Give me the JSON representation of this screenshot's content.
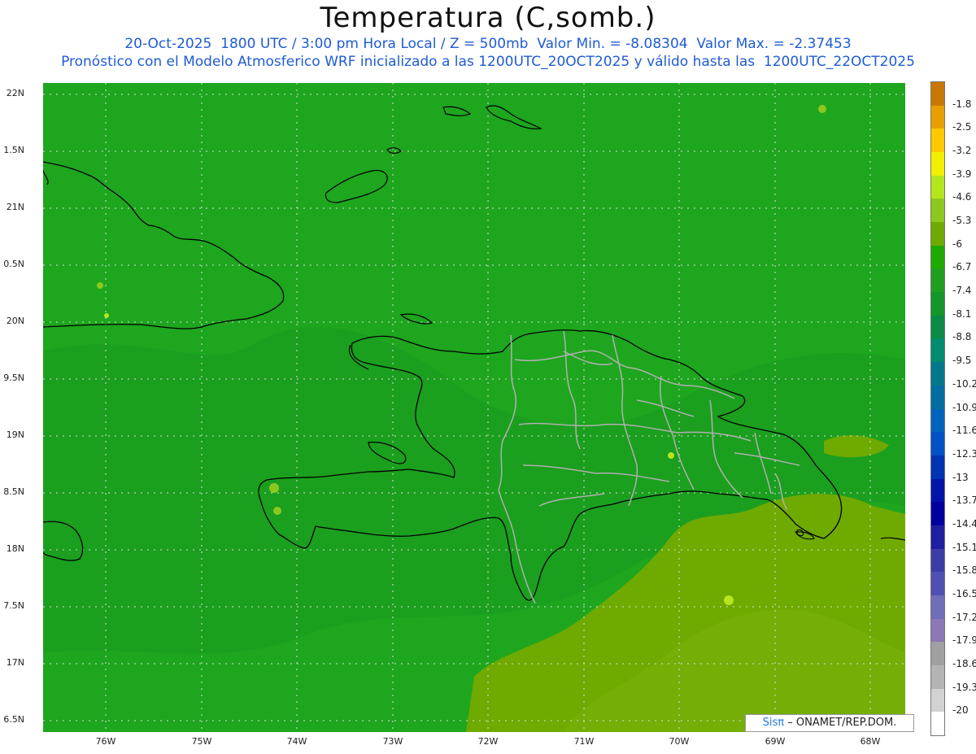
{
  "header": {
    "title": "Temperatura (C,somb.)",
    "line1": "20-Oct-2025  1800 UTC / 3:00 pm Hora Local / Z = 500mb  Valor Min. = -8.08304  Valor Max. = -2.37453",
    "line2": "Pronóstico con el Modelo Atmosferico WRF inicializado a las 1200UTC_20OCT2025 y válido hasta las  1200UTC_22OCT2025"
  },
  "axes": {
    "lat_labels": [
      "22N",
      "1.5N",
      "21N",
      "0.5N",
      "20N",
      "9.5N",
      "19N",
      "8.5N",
      "18N",
      "7.5N",
      "17N",
      "6.5N"
    ],
    "lon_labels": [
      "76W",
      "75W",
      "74W",
      "73W",
      "72W",
      "71W",
      "70W",
      "69W",
      "68W"
    ]
  },
  "colorbar": {
    "labels": [
      "-1.8",
      "-2.5",
      "-3.2",
      "-3.9",
      "-4.6",
      "-5.3",
      "-6",
      "-6.7",
      "-7.4",
      "-8.1",
      "-8.8",
      "-9.5",
      "-10.2",
      "-10.9",
      "-11.6",
      "-12.3",
      "-13",
      "-13.7",
      "-14.4",
      "-15.1",
      "-15.8",
      "-16.5",
      "-17.2",
      "-17.9",
      "-18.6",
      "-19.3",
      "-20"
    ],
    "colors": [
      "#c87800",
      "#e8a000",
      "#ffc800",
      "#f0f000",
      "#b4e61e",
      "#8cc81e",
      "#6eaa00",
      "#1eaa00",
      "#1ea01e",
      "#149628",
      "#0a8c46",
      "#008c6e",
      "#00788c",
      "#006ea0",
      "#0064be",
      "#0050c8",
      "#0032b4",
      "#0014aa",
      "#0000a0",
      "#1e1ea0",
      "#3c3ca8",
      "#5050b4",
      "#6e6eb9",
      "#8c78b4",
      "#a0a0a0",
      "#b4b4b4",
      "#d2d2d2",
      "#ffffff"
    ]
  },
  "credit": {
    "logo": "Sisπ",
    "text": "– ONAMET/REP.DOM."
  },
  "colors": {
    "background_field": "#1ea61e",
    "warm_field": "#6eaa00",
    "coast": "#000000",
    "border": "#aaaaaa",
    "header_text": "#1f5bd6"
  }
}
